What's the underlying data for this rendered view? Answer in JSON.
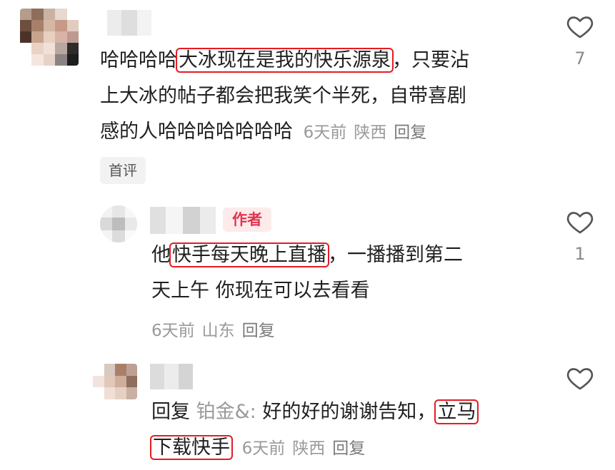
{
  "comments": [
    {
      "line1_pre": "哈哈哈哈",
      "line1_hl": "大冰现在是我的快乐源泉",
      "line1_post": "，只要沾",
      "line2": "上大冰的帖子都会把我笑个半死，自带喜剧",
      "line3": "感的人哈哈哈哈哈哈哈",
      "time": "6天前",
      "location": "陕西",
      "reply": "回复",
      "likes": "7",
      "tag": "首评"
    },
    {
      "badge": "作者",
      "line1_pre": "他",
      "line1_hl": "快手每天晚上直播",
      "line1_post": "，一播播到第二",
      "line2": "天上午 你现在可以去看看",
      "time": "6天前",
      "location": "山东",
      "reply": "回复",
      "likes": "1"
    },
    {
      "reply_prefix": "回复",
      "reply_target": "铂金&:",
      "line1_mid": "好的好的谢谢告知，",
      "line1_hl": "立马",
      "line2_hl": "下载快手",
      "time": "6天前",
      "location": "陕西",
      "reply": "回复"
    }
  ],
  "colors": {
    "highlight_box": "#e51c23",
    "badge_text": "#e0344f",
    "meta_gray": "#9a9a9a"
  },
  "icons": [
    "heart-icon"
  ]
}
